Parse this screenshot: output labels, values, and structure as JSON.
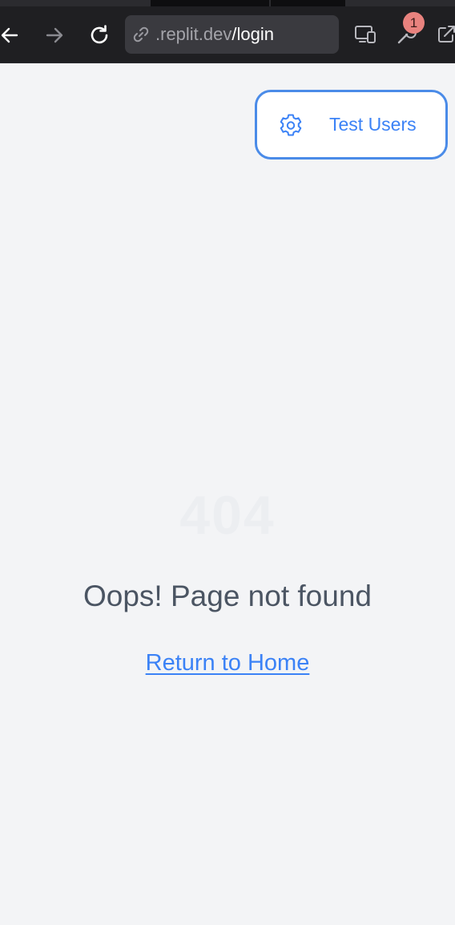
{
  "browser": {
    "url_domain": ".replit.dev",
    "url_path": "/login",
    "extension_badge_count": "1",
    "icons": {
      "back": "arrow-left-icon",
      "forward": "arrow-right-icon",
      "reload": "reload-icon",
      "link": "link-icon",
      "devices": "devices-icon",
      "tools": "wrench-icon",
      "external": "open-external-icon"
    }
  },
  "header": {
    "test_users_label": "Test Users",
    "test_users_icon": "gear-icon"
  },
  "main": {
    "error_code": "404",
    "message": "Oops! Page not found",
    "home_link_label": "Return to Home"
  },
  "colors": {
    "accent": "#3b82f6",
    "page_background": "#f3f4f6",
    "message_text": "#4b5563"
  }
}
